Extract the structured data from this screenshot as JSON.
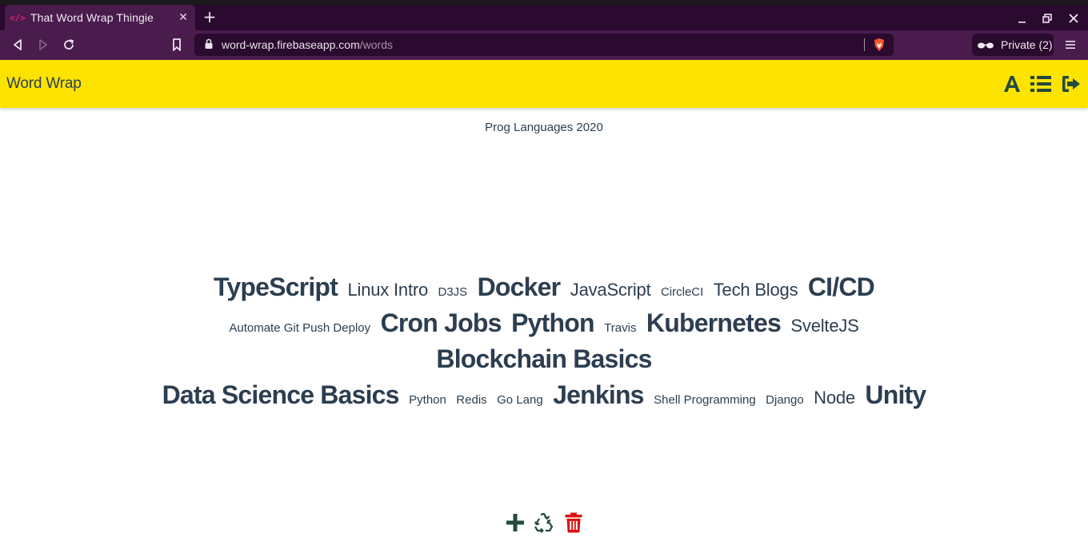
{
  "browser": {
    "tab": {
      "title": "That Word Wrap Thingie",
      "favicon": "code-icon"
    },
    "url": {
      "host": "word-wrap.firebaseapp.com",
      "path": "/words"
    },
    "private_label": "Private (2)"
  },
  "app": {
    "brand": "Word Wrap",
    "header_icons": [
      "font-icon",
      "list-icon",
      "sign-out-icon"
    ],
    "accent_color": "#fce300"
  },
  "list": {
    "title": "Prog Languages 2020"
  },
  "words": {
    "typescript": "TypeScript",
    "linux_intro": "Linux Intro",
    "d3js": "D3JS",
    "docker": "Docker",
    "javascript": "JavaScript",
    "circleci": "CircleCI",
    "tech_blogs": "Tech Blogs",
    "cicd": "CI/CD",
    "automate_git": "Automate Git Push Deploy",
    "cron_jobs": "Cron Jobs",
    "python_big": "Python",
    "travis": "Travis",
    "kubernetes": "Kubernetes",
    "sveltejs": "SvelteJS",
    "blockchain": "Blockchain Basics",
    "data_science": "Data Science Basics",
    "python_small": "Python",
    "redis": "Redis",
    "go_lang": "Go Lang",
    "jenkins": "Jenkins",
    "shell": "Shell Programming",
    "django": "Django",
    "node": "Node",
    "unity": "Unity"
  },
  "toolbar": {
    "icons": [
      "plus-icon",
      "recycle-icon",
      "trash-icon"
    ],
    "colors": {
      "plus": "#234a3f",
      "recycle": "#234a3f",
      "trash": "#e01010"
    }
  }
}
